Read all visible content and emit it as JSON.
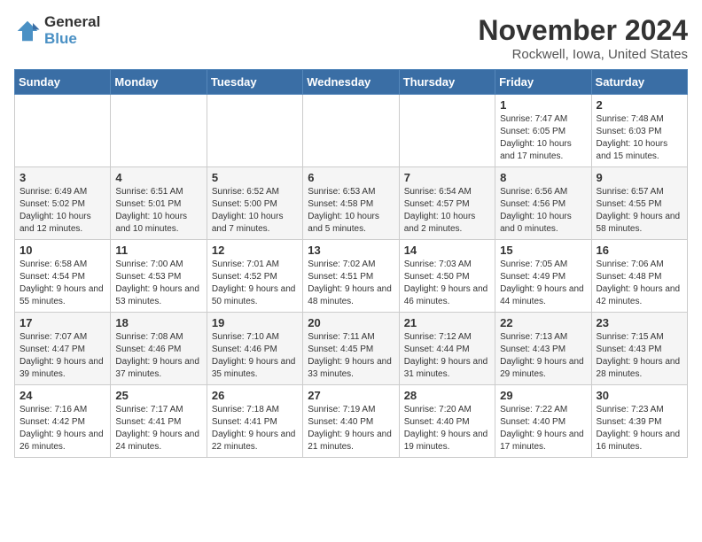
{
  "header": {
    "logo_general": "General",
    "logo_blue": "Blue",
    "month_title": "November 2024",
    "location": "Rockwell, Iowa, United States"
  },
  "weekdays": [
    "Sunday",
    "Monday",
    "Tuesday",
    "Wednesday",
    "Thursday",
    "Friday",
    "Saturday"
  ],
  "weeks": [
    [
      {
        "day": "",
        "info": ""
      },
      {
        "day": "",
        "info": ""
      },
      {
        "day": "",
        "info": ""
      },
      {
        "day": "",
        "info": ""
      },
      {
        "day": "",
        "info": ""
      },
      {
        "day": "1",
        "info": "Sunrise: 7:47 AM\nSunset: 6:05 PM\nDaylight: 10 hours and 17 minutes."
      },
      {
        "day": "2",
        "info": "Sunrise: 7:48 AM\nSunset: 6:03 PM\nDaylight: 10 hours and 15 minutes."
      }
    ],
    [
      {
        "day": "3",
        "info": "Sunrise: 6:49 AM\nSunset: 5:02 PM\nDaylight: 10 hours and 12 minutes."
      },
      {
        "day": "4",
        "info": "Sunrise: 6:51 AM\nSunset: 5:01 PM\nDaylight: 10 hours and 10 minutes."
      },
      {
        "day": "5",
        "info": "Sunrise: 6:52 AM\nSunset: 5:00 PM\nDaylight: 10 hours and 7 minutes."
      },
      {
        "day": "6",
        "info": "Sunrise: 6:53 AM\nSunset: 4:58 PM\nDaylight: 10 hours and 5 minutes."
      },
      {
        "day": "7",
        "info": "Sunrise: 6:54 AM\nSunset: 4:57 PM\nDaylight: 10 hours and 2 minutes."
      },
      {
        "day": "8",
        "info": "Sunrise: 6:56 AM\nSunset: 4:56 PM\nDaylight: 10 hours and 0 minutes."
      },
      {
        "day": "9",
        "info": "Sunrise: 6:57 AM\nSunset: 4:55 PM\nDaylight: 9 hours and 58 minutes."
      }
    ],
    [
      {
        "day": "10",
        "info": "Sunrise: 6:58 AM\nSunset: 4:54 PM\nDaylight: 9 hours and 55 minutes."
      },
      {
        "day": "11",
        "info": "Sunrise: 7:00 AM\nSunset: 4:53 PM\nDaylight: 9 hours and 53 minutes."
      },
      {
        "day": "12",
        "info": "Sunrise: 7:01 AM\nSunset: 4:52 PM\nDaylight: 9 hours and 50 minutes."
      },
      {
        "day": "13",
        "info": "Sunrise: 7:02 AM\nSunset: 4:51 PM\nDaylight: 9 hours and 48 minutes."
      },
      {
        "day": "14",
        "info": "Sunrise: 7:03 AM\nSunset: 4:50 PM\nDaylight: 9 hours and 46 minutes."
      },
      {
        "day": "15",
        "info": "Sunrise: 7:05 AM\nSunset: 4:49 PM\nDaylight: 9 hours and 44 minutes."
      },
      {
        "day": "16",
        "info": "Sunrise: 7:06 AM\nSunset: 4:48 PM\nDaylight: 9 hours and 42 minutes."
      }
    ],
    [
      {
        "day": "17",
        "info": "Sunrise: 7:07 AM\nSunset: 4:47 PM\nDaylight: 9 hours and 39 minutes."
      },
      {
        "day": "18",
        "info": "Sunrise: 7:08 AM\nSunset: 4:46 PM\nDaylight: 9 hours and 37 minutes."
      },
      {
        "day": "19",
        "info": "Sunrise: 7:10 AM\nSunset: 4:46 PM\nDaylight: 9 hours and 35 minutes."
      },
      {
        "day": "20",
        "info": "Sunrise: 7:11 AM\nSunset: 4:45 PM\nDaylight: 9 hours and 33 minutes."
      },
      {
        "day": "21",
        "info": "Sunrise: 7:12 AM\nSunset: 4:44 PM\nDaylight: 9 hours and 31 minutes."
      },
      {
        "day": "22",
        "info": "Sunrise: 7:13 AM\nSunset: 4:43 PM\nDaylight: 9 hours and 29 minutes."
      },
      {
        "day": "23",
        "info": "Sunrise: 7:15 AM\nSunset: 4:43 PM\nDaylight: 9 hours and 28 minutes."
      }
    ],
    [
      {
        "day": "24",
        "info": "Sunrise: 7:16 AM\nSunset: 4:42 PM\nDaylight: 9 hours and 26 minutes."
      },
      {
        "day": "25",
        "info": "Sunrise: 7:17 AM\nSunset: 4:41 PM\nDaylight: 9 hours and 24 minutes."
      },
      {
        "day": "26",
        "info": "Sunrise: 7:18 AM\nSunset: 4:41 PM\nDaylight: 9 hours and 22 minutes."
      },
      {
        "day": "27",
        "info": "Sunrise: 7:19 AM\nSunset: 4:40 PM\nDaylight: 9 hours and 21 minutes."
      },
      {
        "day": "28",
        "info": "Sunrise: 7:20 AM\nSunset: 4:40 PM\nDaylight: 9 hours and 19 minutes."
      },
      {
        "day": "29",
        "info": "Sunrise: 7:22 AM\nSunset: 4:40 PM\nDaylight: 9 hours and 17 minutes."
      },
      {
        "day": "30",
        "info": "Sunrise: 7:23 AM\nSunset: 4:39 PM\nDaylight: 9 hours and 16 minutes."
      }
    ]
  ],
  "row_classes": [
    "row-1",
    "row-2",
    "row-3",
    "row-4",
    "row-5"
  ]
}
